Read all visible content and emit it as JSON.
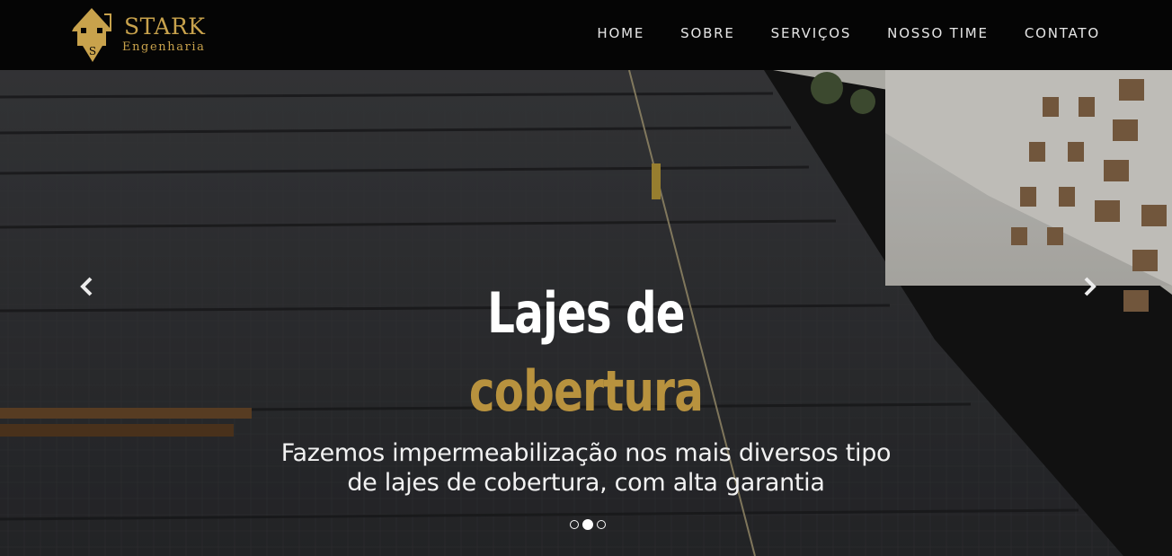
{
  "brand": {
    "name": "STARK",
    "tagline": "Engenharia",
    "logo_letter": "S",
    "color": "#c8a24c"
  },
  "nav": {
    "items": [
      {
        "label": "HOME"
      },
      {
        "label": "SOBRE"
      },
      {
        "label": "SERVIÇOS"
      },
      {
        "label": "NOSSO TIME"
      },
      {
        "label": "CONTATO"
      }
    ]
  },
  "hero": {
    "title_line1": "Lajes de",
    "title_line2": "cobertura",
    "subtitle_line1": "Fazemos impermeabilização nos mais diversos tipo",
    "subtitle_line2": "de lajes de cobertura, com alta garantia",
    "accent_color": "#b8923e",
    "prev_icon": "chevron-left-icon",
    "next_icon": "chevron-right-icon",
    "slides": 3,
    "active_slide": 2
  }
}
